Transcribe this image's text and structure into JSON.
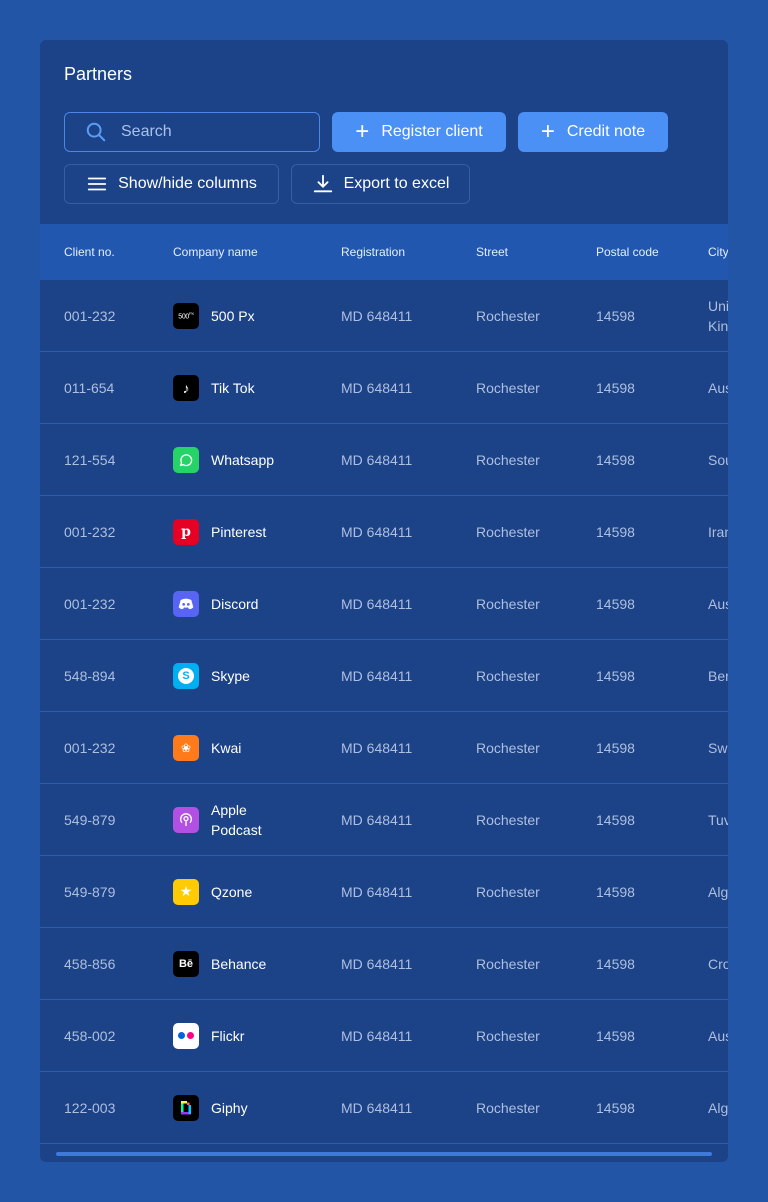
{
  "panel": {
    "title": "Partners"
  },
  "toolbar": {
    "search_placeholder": "Search",
    "register_label": "Register client",
    "credit_label": "Credit note",
    "columns_label": "Show/hide columns",
    "export_label": "Export to excel"
  },
  "table": {
    "headers": [
      "Client no.",
      "Company name",
      "Registration",
      "Street",
      "Postal code",
      "City"
    ],
    "rows": [
      {
        "client": "001-232",
        "company": "500 Px",
        "logo": "500px-logo",
        "registration": "MD 648411",
        "street": "Rochester",
        "postal": "14598",
        "city": "United Kingdom"
      },
      {
        "client": "011-654",
        "company": "Tik Tok",
        "logo": "tiktok-logo",
        "registration": "MD 648411",
        "street": "Rochester",
        "postal": "14598",
        "city": "Austria"
      },
      {
        "client": "121-554",
        "company": "Whatsapp",
        "logo": "whatsapp-logo",
        "registration": "MD 648411",
        "street": "Rochester",
        "postal": "14598",
        "city": "South"
      },
      {
        "client": "001-232",
        "company": "Pinterest",
        "logo": "pinterest-logo",
        "registration": "MD 648411",
        "street": "Rochester",
        "postal": "14598",
        "city": "Iran"
      },
      {
        "client": "001-232",
        "company": "Discord",
        "logo": "discord-logo",
        "registration": "MD 648411",
        "street": "Rochester",
        "postal": "14598",
        "city": "Austria"
      },
      {
        "client": "548-894",
        "company": "Skype",
        "logo": "skype-logo",
        "registration": "MD 648411",
        "street": "Rochester",
        "postal": "14598",
        "city": "Bermuda"
      },
      {
        "client": "001-232",
        "company": "Kwai",
        "logo": "kwai-logo",
        "registration": "MD 648411",
        "street": "Rochester",
        "postal": "14598",
        "city": "Sweden"
      },
      {
        "client": "549-879",
        "company": "Apple Podcast",
        "logo": "apple-podcast-logo",
        "registration": "MD 648411",
        "street": "Rochester",
        "postal": "14598",
        "city": "Tuvalu"
      },
      {
        "client": "549-879",
        "company": "Qzone",
        "logo": "qzone-logo",
        "registration": "MD 648411",
        "street": "Rochester",
        "postal": "14598",
        "city": "Algeria"
      },
      {
        "client": "458-856",
        "company": "Behance",
        "logo": "behance-logo",
        "registration": "MD 648411",
        "street": "Rochester",
        "postal": "14598",
        "city": "Croatia"
      },
      {
        "client": "458-002",
        "company": "Flickr",
        "logo": "flickr-logo",
        "registration": "MD 648411",
        "street": "Rochester",
        "postal": "14598",
        "city": "Austria"
      },
      {
        "client": "122-003",
        "company": "Giphy",
        "logo": "giphy-logo",
        "registration": "MD 648411",
        "street": "Rochester",
        "postal": "14598",
        "city": "Algeria"
      }
    ]
  },
  "colors": {
    "background": "#2355a6",
    "panel": "#1c4288",
    "header": "#2157ae",
    "primary": "#4a90f5"
  }
}
